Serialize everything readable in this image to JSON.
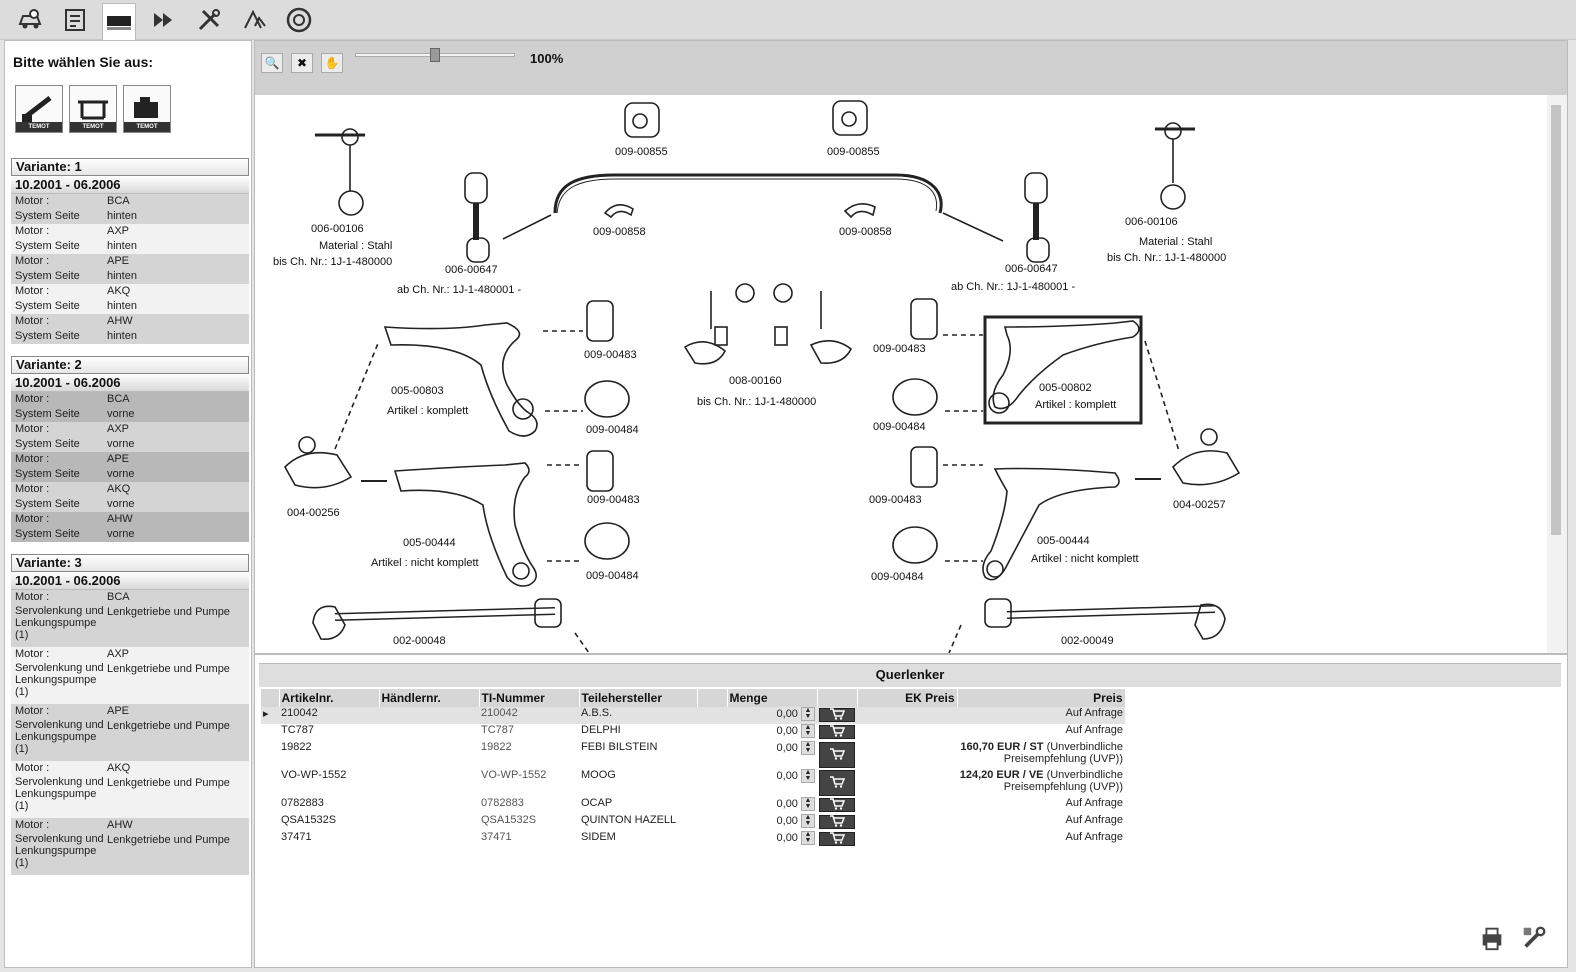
{
  "toolbar": {
    "icons": [
      "vehicle-search-icon",
      "parts-list-icon",
      "temot-brand-icon",
      "forward-icon",
      "tools-icon",
      "catalog-a-icon",
      "wheel-icon"
    ]
  },
  "left": {
    "heading": "Bitte wählen Sie aus:",
    "brands": [
      "TEMOT",
      "TEMOT",
      "TEMOT"
    ],
    "variants": [
      {
        "title": "Variante: 1",
        "date": "10.2001 - 06.2006",
        "rows": [
          {
            "motor_label": "Motor :",
            "motor": "BCA",
            "side_label": "System Seite",
            "side": "hinten"
          },
          {
            "motor_label": "Motor :",
            "motor": "AXP",
            "side_label": "System Seite",
            "side": "hinten"
          },
          {
            "motor_label": "Motor :",
            "motor": "APE",
            "side_label": "System Seite",
            "side": "hinten"
          },
          {
            "motor_label": "Motor :",
            "motor": "AKQ",
            "side_label": "System Seite",
            "side": "hinten"
          },
          {
            "motor_label": "Motor :",
            "motor": "AHW",
            "side_label": "System Seite",
            "side": "hinten"
          }
        ]
      },
      {
        "title": "Variante: 2",
        "date": "10.2001 - 06.2006",
        "rows": [
          {
            "motor_label": "Motor :",
            "motor": "BCA",
            "side_label": "System Seite",
            "side": "vorne"
          },
          {
            "motor_label": "Motor :",
            "motor": "AXP",
            "side_label": "System Seite",
            "side": "vorne"
          },
          {
            "motor_label": "Motor :",
            "motor": "APE",
            "side_label": "System Seite",
            "side": "vorne"
          },
          {
            "motor_label": "Motor :",
            "motor": "AKQ",
            "side_label": "System Seite",
            "side": "vorne"
          },
          {
            "motor_label": "Motor :",
            "motor": "AHW",
            "side_label": "System Seite",
            "side": "vorne"
          }
        ]
      },
      {
        "title": "Variante: 3",
        "date": "10.2001 - 06.2006",
        "rows": [
          {
            "motor_label": "Motor :",
            "motor": "BCA",
            "k2": "Servolenkung und Lenkungspumpe (1)",
            "v2": "Lenkgetriebe und Pumpe"
          },
          {
            "motor_label": "Motor :",
            "motor": "AXP",
            "k2": "Servolenkung und Lenkungspumpe (1)",
            "v2": "Lenkgetriebe und Pumpe"
          },
          {
            "motor_label": "Motor :",
            "motor": "APE",
            "k2": "Servolenkung und Lenkungspumpe (1)",
            "v2": "Lenkgetriebe und Pumpe"
          },
          {
            "motor_label": "Motor :",
            "motor": "AKQ",
            "k2": "Servolenkung und Lenkungspumpe (1)",
            "v2": "Lenkgetriebe und Pumpe"
          },
          {
            "motor_label": "Motor :",
            "motor": "AHW",
            "k2": "Servolenkung und Lenkungspumpe (1)",
            "v2": "Lenkgetriebe und Pumpe"
          }
        ]
      }
    ]
  },
  "viewer": {
    "zoom": "100%",
    "labels": {
      "a1": "009-00855",
      "a2": "009-00855",
      "b1": "006-00106",
      "b1m": "Material : Stahl",
      "b1c": "bis Ch. Nr.: 1J-1-480000",
      "b2": "006-00106",
      "b2m": "Material : Stahl",
      "b2c": "bis Ch. Nr.: 1J-1-480000",
      "c1": "009-00858",
      "c2": "009-00858",
      "d1": "006-00647",
      "d1c": "ab Ch. Nr.: 1J-1-480001 -",
      "d2": "006-00647",
      "d2c": "ab Ch. Nr.: 1J-1-480001 -",
      "e1": "009-00483",
      "e2": "009-00483",
      "e3": "009-00483",
      "e4": "009-00483",
      "f1": "005-00803",
      "f1a": "Artikel : komplett",
      "f2": "005-00802",
      "f2a": "Artikel : komplett",
      "g1": "009-00484",
      "g2": "009-00484",
      "g3": "009-00484",
      "g4": "009-00484",
      "h1": "008-00160",
      "h1c": "bis Ch. Nr.: 1J-1-480000",
      "i1": "004-00256",
      "i2": "004-00257",
      "j1": "005-00444",
      "j1a": "Artikel : nicht komplett",
      "j2": "005-00444",
      "j2a": "Artikel : nicht komplett",
      "k1": "002-00048",
      "k2": "002-00049"
    }
  },
  "parts": {
    "title": "Querlenker",
    "headers": [
      "Artikelnr.",
      "Händlernr.",
      "TI-Nummer",
      "Teilehersteller",
      "",
      "Menge",
      "",
      "EK Preis",
      "Preis"
    ],
    "rows": [
      {
        "art": "210042",
        "ti": "210042",
        "maker": "A.B.S.",
        "qty": "0,00",
        "price": "Auf Anfrage",
        "selected": true
      },
      {
        "art": "TC787",
        "ti": "TC787",
        "maker": "DELPHI",
        "qty": "0,00",
        "price": "Auf Anfrage"
      },
      {
        "art": "19822",
        "ti": "19822",
        "maker": "FEBI BILSTEIN",
        "qty": "0,00",
        "price_bold": "160,70 EUR / ST",
        "price_note": "(Unverbindliche Preisempfehlung (UVP))"
      },
      {
        "art": "VO-WP-1552",
        "ti": "VO-WP-1552",
        "maker": "MOOG",
        "qty": "0,00",
        "price_bold": "124,20 EUR / VE",
        "price_note": "(Unverbindliche Preisempfehlung (UVP))"
      },
      {
        "art": "0782883",
        "ti": "0782883",
        "maker": "OCAP",
        "qty": "0,00",
        "price": "Auf Anfrage"
      },
      {
        "art": "QSA1532S",
        "ti": "QSA1532S",
        "maker": "QUINTON HAZELL",
        "qty": "0,00",
        "price": "Auf Anfrage"
      },
      {
        "art": "37471",
        "ti": "37471",
        "maker": "SIDEM",
        "qty": "0,00",
        "price": "Auf Anfrage"
      }
    ]
  }
}
